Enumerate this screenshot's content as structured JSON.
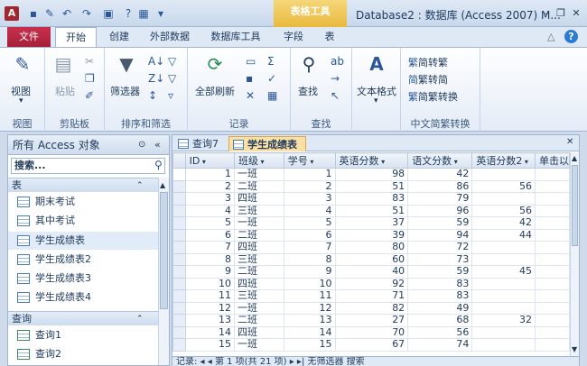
{
  "titlebar": {
    "context_tab_group": "表格工具",
    "window_title": "Database2 : 数据库 (Access 2007) M..."
  },
  "tabs": {
    "file": "文件",
    "home": "开始",
    "create": "创建",
    "external": "外部数据",
    "dbtools": "数据库工具",
    "fields": "字段",
    "table": "表"
  },
  "ribbon": {
    "views": {
      "group": "视图",
      "view_btn": "视图"
    },
    "clipboard": {
      "group": "剪贴板",
      "paste_btn": "粘贴"
    },
    "sortfilter": {
      "group": "排序和筛选",
      "filter_btn": "筛选器"
    },
    "records": {
      "group": "记录",
      "refresh_btn": "全部刷新"
    },
    "find": {
      "group": "查找",
      "find_btn": "查找"
    },
    "textformat": {
      "text_btn": "文本格式"
    },
    "chinese": {
      "group": "中文简繁转换",
      "to_trad": "简转繁",
      "to_simp": "繁转简",
      "convert": "简繁转换"
    }
  },
  "nav": {
    "title": "所有 Access 对象",
    "search_placeholder": "搜索...",
    "tables_header": "表",
    "tables": [
      "期末考试",
      "其中考试",
      "学生成绩表",
      "学生成绩表2",
      "学生成绩表3",
      "学生成绩表4"
    ],
    "queries_header": "查询",
    "queries": [
      "查询1",
      "查询2"
    ]
  },
  "doc": {
    "tabs": [
      "查询7",
      "学生成绩表"
    ],
    "columns": [
      "ID",
      "班级",
      "学号",
      "英语分数",
      "语文分数",
      "英语分数2",
      "单击以"
    ],
    "rows": [
      [
        "1",
        "一班",
        "1",
        "98",
        "42",
        ""
      ],
      [
        "2",
        "二班",
        "2",
        "51",
        "86",
        "56"
      ],
      [
        "3",
        "四班",
        "3",
        "83",
        "79",
        ""
      ],
      [
        "4",
        "三班",
        "4",
        "51",
        "96",
        "56"
      ],
      [
        "5",
        "一班",
        "5",
        "37",
        "59",
        "42"
      ],
      [
        "6",
        "二班",
        "6",
        "39",
        "94",
        "44"
      ],
      [
        "7",
        "四班",
        "7",
        "80",
        "72",
        ""
      ],
      [
        "8",
        "三班",
        "8",
        "60",
        "73",
        ""
      ],
      [
        "9",
        "二班",
        "9",
        "40",
        "59",
        "45"
      ],
      [
        "10",
        "四班",
        "10",
        "92",
        "83",
        ""
      ],
      [
        "11",
        "三班",
        "11",
        "71",
        "83",
        ""
      ],
      [
        "12",
        "一班",
        "12",
        "82",
        "49",
        ""
      ],
      [
        "13",
        "二班",
        "13",
        "27",
        "68",
        "32"
      ],
      [
        "14",
        "四班",
        "14",
        "70",
        "56",
        ""
      ],
      [
        "15",
        "一班",
        "15",
        "67",
        "74",
        ""
      ]
    ],
    "record_nav": "记录: ◂ ◂ 第 1 项(共 21 项) ▸ ▸|  无筛选器  搜索"
  }
}
